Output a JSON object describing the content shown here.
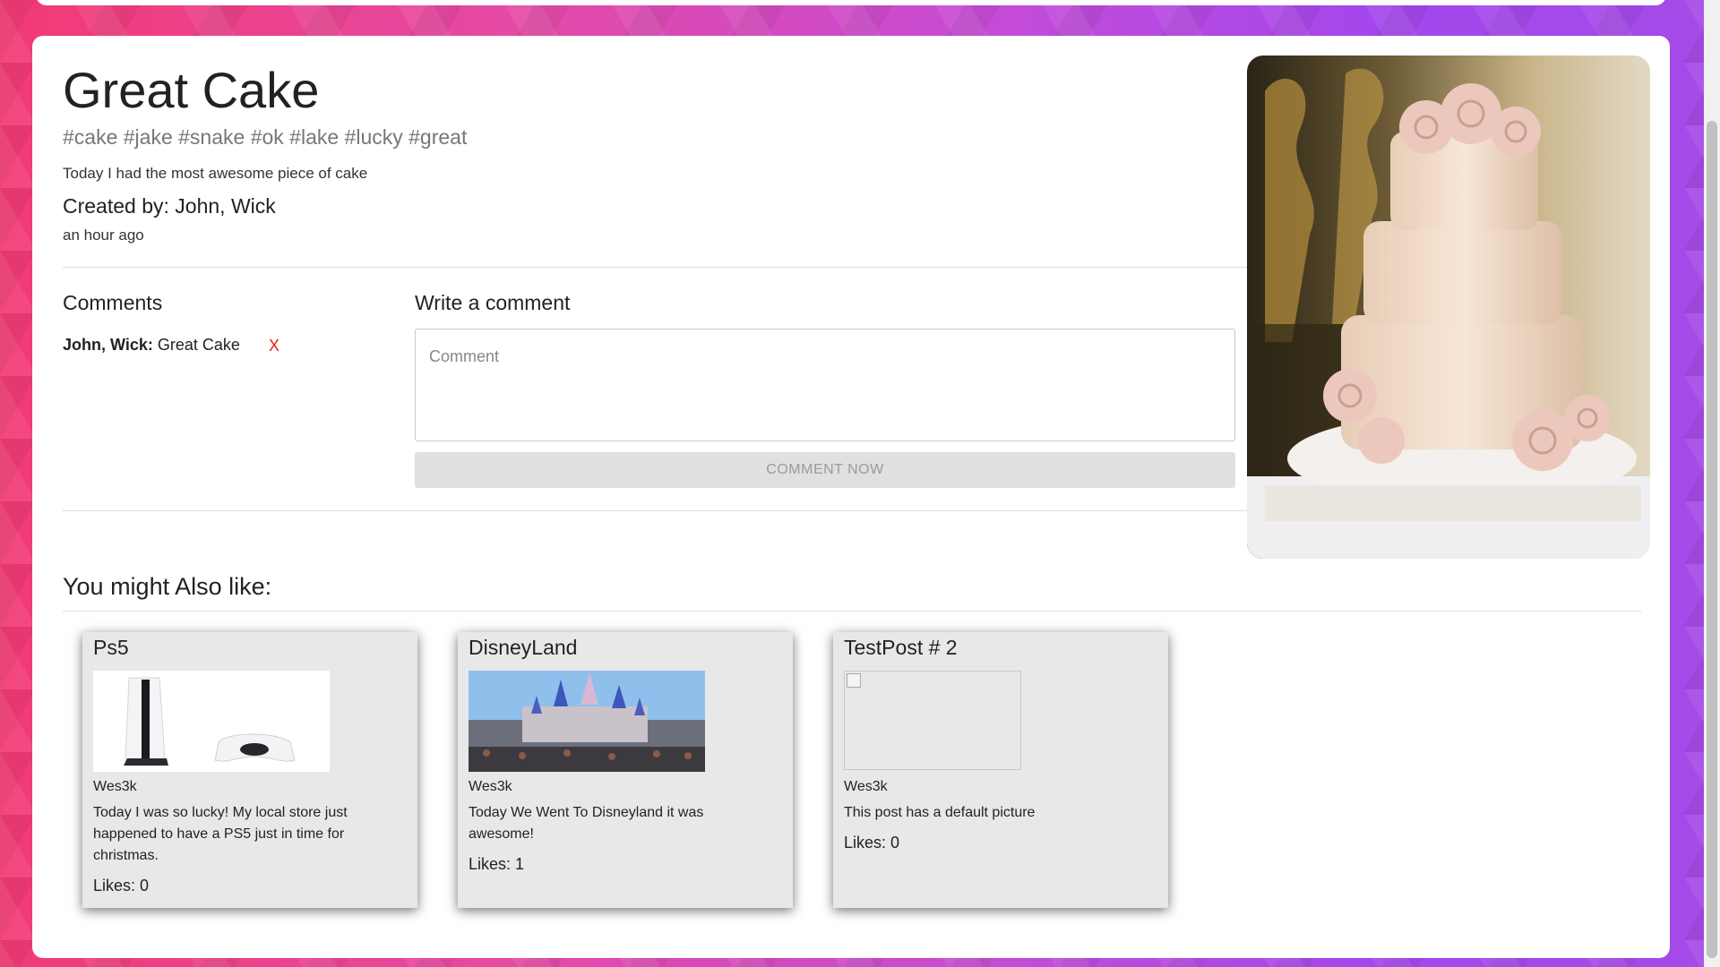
{
  "post": {
    "title": "Great Cake",
    "tags": "#cake #jake #snake #ok #lake #lucky #great",
    "description": "Today I had the most awesome piece of cake",
    "created_by": "Created by: John, Wick",
    "time_ago": "an hour ago",
    "image_icon": "cake-photo"
  },
  "comments": {
    "heading": "Comments",
    "items": [
      {
        "author": "John, Wick:",
        "text": "Great Cake",
        "delete_label": "X"
      }
    ]
  },
  "write_comment": {
    "heading": "Write a comment",
    "placeholder": "Comment",
    "value": "",
    "button_label": "COMMENT NOW"
  },
  "suggestions": {
    "heading": "You might Also like:",
    "cards": [
      {
        "title": "Ps5",
        "author": "Wes3k",
        "text": "Today I was so lucky! My local store just happened to have a PS5 just in time for christmas.",
        "likes": "Likes: 0",
        "image_icon": "ps5-console-photo"
      },
      {
        "title": "DisneyLand",
        "author": "Wes3k",
        "text": "Today We Went To Disneyland it was awesome!",
        "likes": "Likes: 1",
        "image_icon": "castle-photo"
      },
      {
        "title": "TestPost # 2",
        "author": "Wes3k",
        "text": "This post has a default picture",
        "likes": "Likes: 0",
        "image_icon": "broken-image-icon"
      }
    ]
  },
  "colors": {
    "delete": "#e0201f",
    "card_bg": "#e8e8e8",
    "tag_text": "#777777",
    "button_bg": "#e0e0e0",
    "button_text": "#9a9a9a"
  }
}
